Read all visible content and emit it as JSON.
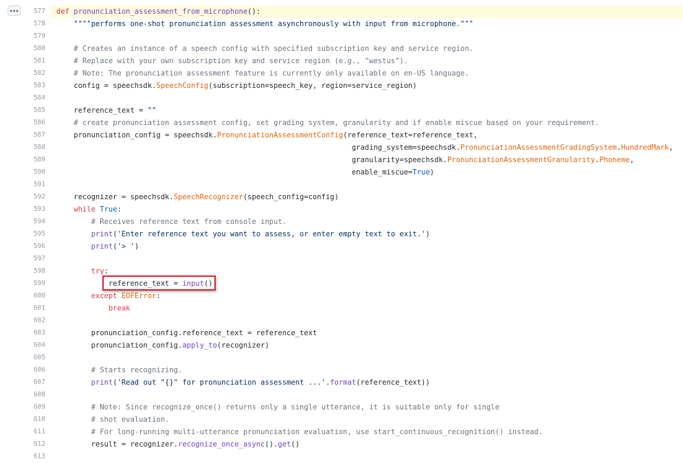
{
  "code": {
    "lines": [
      {
        "n": "577",
        "tokens": [
          [
            "k",
            "def "
          ],
          [
            "f",
            "pronunciation_assessment_from_microphone"
          ],
          [
            "",
            "():"
          ]
        ]
      },
      {
        "n": "578",
        "tokens": [
          [
            "",
            "    "
          ],
          [
            "s",
            "\"\"\"\"performs one-shot pronunciation assessment asynchronously with input from microphone.\"\"\""
          ]
        ]
      },
      {
        "n": "579",
        "tokens": []
      },
      {
        "n": "580",
        "tokens": [
          [
            "",
            "    "
          ],
          [
            "c",
            "# Creates an instance of a speech config with specified subscription key and service region."
          ]
        ]
      },
      {
        "n": "581",
        "tokens": [
          [
            "",
            "    "
          ],
          [
            "c",
            "# Replace with your own subscription key and service region (e.g., \"westus\")."
          ]
        ]
      },
      {
        "n": "582",
        "tokens": [
          [
            "",
            "    "
          ],
          [
            "c",
            "# Note: The pronunciation assessment feature is currently only available on en-US language."
          ]
        ]
      },
      {
        "n": "583",
        "tokens": [
          [
            "",
            "    config = speechsdk."
          ],
          [
            "e",
            "SpeechConfig"
          ],
          [
            "",
            "(subscription=speech_key, region=service_region)"
          ]
        ]
      },
      {
        "n": "584",
        "tokens": []
      },
      {
        "n": "585",
        "tokens": [
          [
            "",
            "    reference_text = "
          ],
          [
            "s",
            "\"\""
          ]
        ]
      },
      {
        "n": "586",
        "tokens": [
          [
            "",
            "    "
          ],
          [
            "c",
            "# create pronunciation assessment config, set grading system, granularity and if enable miscue based on your requirement."
          ]
        ]
      },
      {
        "n": "587",
        "tokens": [
          [
            "",
            "    pronunciation_config = speechsdk."
          ],
          [
            "e",
            "PronunciationAssessmentConfig"
          ],
          [
            "",
            "(reference_text=reference_text,"
          ]
        ]
      },
      {
        "n": "588",
        "tokens": [
          [
            "",
            "                                                                    grading_system=speechsdk."
          ],
          [
            "e",
            "PronunciationAssessmentGradingSystem"
          ],
          [
            "",
            "."
          ],
          [
            "e",
            "HundredMark"
          ],
          [
            "",
            ","
          ]
        ]
      },
      {
        "n": "589",
        "tokens": [
          [
            "",
            "                                                                    granularity=speechsdk."
          ],
          [
            "e",
            "PronunciationAssessmentGranularity"
          ],
          [
            "",
            "."
          ],
          [
            "e",
            "Phoneme"
          ],
          [
            "",
            ","
          ]
        ]
      },
      {
        "n": "590",
        "tokens": [
          [
            "",
            "                                                                    enable_miscue="
          ],
          [
            "b",
            "True"
          ],
          [
            "",
            ")"
          ]
        ]
      },
      {
        "n": "591",
        "tokens": []
      },
      {
        "n": "592",
        "tokens": [
          [
            "",
            "    recognizer = speechsdk."
          ],
          [
            "e",
            "SpeechRecognizer"
          ],
          [
            "",
            "(speech_config=config)"
          ]
        ]
      },
      {
        "n": "593",
        "tokens": [
          [
            "",
            "    "
          ],
          [
            "k",
            "while "
          ],
          [
            "b",
            "True"
          ],
          [
            "",
            ":"
          ]
        ]
      },
      {
        "n": "594",
        "tokens": [
          [
            "",
            "        "
          ],
          [
            "c",
            "# Receives reference text from console input."
          ]
        ]
      },
      {
        "n": "595",
        "tokens": [
          [
            "",
            "        "
          ],
          [
            "f",
            "print"
          ],
          [
            "",
            "("
          ],
          [
            "s",
            "'Enter reference text you want to assess, or enter empty text to exit.'"
          ],
          [
            "",
            ")"
          ]
        ]
      },
      {
        "n": "596",
        "tokens": [
          [
            "",
            "        "
          ],
          [
            "f",
            "print"
          ],
          [
            "",
            "("
          ],
          [
            "s",
            "'> '"
          ],
          [
            "",
            ")"
          ]
        ]
      },
      {
        "n": "597",
        "tokens": []
      },
      {
        "n": "598",
        "tokens": [
          [
            "",
            "        "
          ],
          [
            "k",
            "try"
          ],
          [
            "",
            ":"
          ]
        ]
      },
      {
        "n": "599",
        "tokens": [
          [
            "",
            "            reference_text = "
          ],
          [
            "f",
            "input"
          ],
          [
            "",
            "()"
          ]
        ]
      },
      {
        "n": "600",
        "tokens": [
          [
            "",
            "        "
          ],
          [
            "k",
            "except "
          ],
          [
            "e",
            "EOFError"
          ],
          [
            "",
            ":"
          ]
        ]
      },
      {
        "n": "601",
        "tokens": [
          [
            "",
            "            "
          ],
          [
            "k",
            "break"
          ]
        ]
      },
      {
        "n": "602",
        "tokens": []
      },
      {
        "n": "603",
        "tokens": [
          [
            "",
            "        pronunciation_config.reference_text = reference_text"
          ]
        ]
      },
      {
        "n": "604",
        "tokens": [
          [
            "",
            "        pronunciation_config."
          ],
          [
            "f",
            "apply_to"
          ],
          [
            "",
            "(recognizer)"
          ]
        ]
      },
      {
        "n": "605",
        "tokens": []
      },
      {
        "n": "606",
        "tokens": [
          [
            "",
            "        "
          ],
          [
            "c",
            "# Starts recognizing."
          ]
        ]
      },
      {
        "n": "607",
        "tokens": [
          [
            "",
            "        "
          ],
          [
            "f",
            "print"
          ],
          [
            "",
            "("
          ],
          [
            "s",
            "'Read out \"{}\" for pronunciation assessment ...'"
          ],
          [
            "",
            "."
          ],
          [
            "f",
            "format"
          ],
          [
            "",
            "(reference_text))"
          ]
        ]
      },
      {
        "n": "608",
        "tokens": []
      },
      {
        "n": "609",
        "tokens": [
          [
            "",
            "        "
          ],
          [
            "c",
            "# Note: Since recognize_once() returns only a single utterance, it is suitable only for single"
          ]
        ]
      },
      {
        "n": "610",
        "tokens": [
          [
            "",
            "        "
          ],
          [
            "c",
            "# shot evaluation."
          ]
        ]
      },
      {
        "n": "611",
        "tokens": [
          [
            "",
            "        "
          ],
          [
            "c",
            "# For long-running multi-utterance pronunciation evaluation, use start_continuous_recognition() instead."
          ]
        ]
      },
      {
        "n": "612",
        "tokens": [
          [
            "",
            "        result = recognizer."
          ],
          [
            "f",
            "recognize_once_async"
          ],
          [
            "",
            "()."
          ],
          [
            "f",
            "get"
          ],
          [
            "",
            "()"
          ]
        ]
      },
      {
        "n": "613",
        "tokens": []
      }
    ],
    "highlighted_line": "577",
    "annotated_line": "599"
  },
  "icons": {
    "menu": "kebab-horizontal-icon"
  },
  "colors": {
    "highlight_box": "#e0202a",
    "line_highlight": "#fffbdd",
    "keyword": "#d73a49",
    "function": "#6f42c1",
    "comment": "#6a737d",
    "string": "#032f62",
    "class": "#e36209"
  }
}
